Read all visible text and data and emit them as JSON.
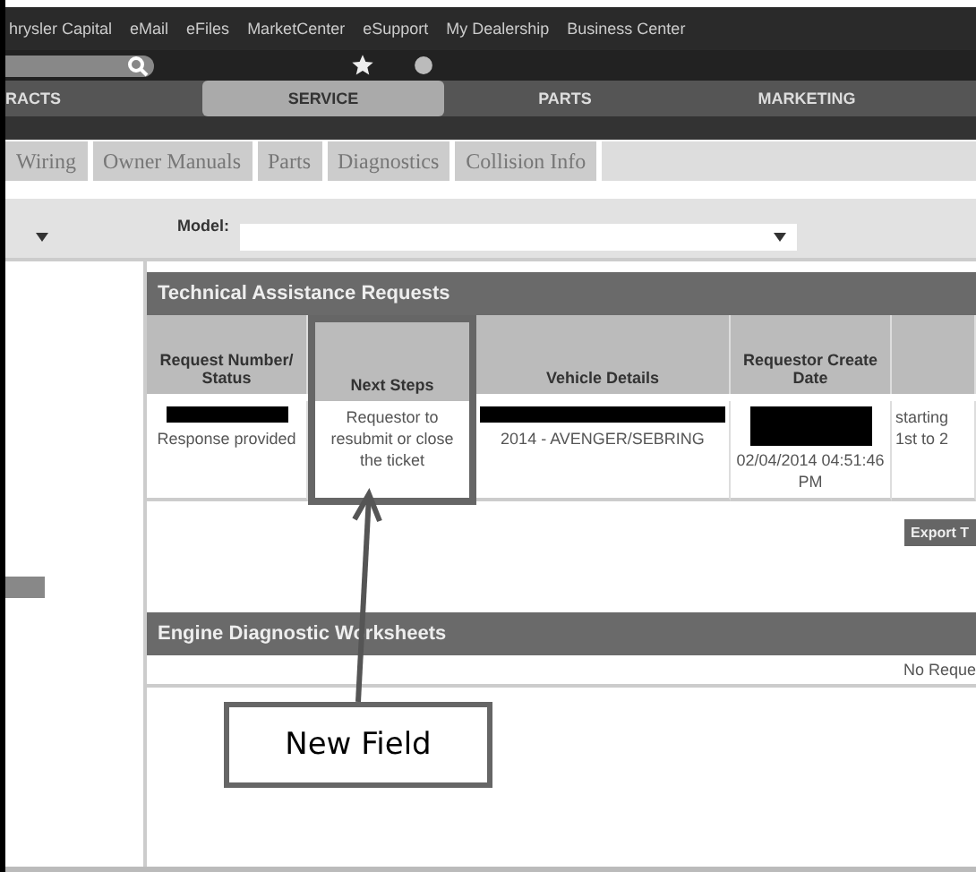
{
  "top_links": [
    "hrysler Capital",
    "eMail",
    "eFiles",
    "MarketCenter",
    "eSupport",
    "My Dealership",
    "Business Center"
  ],
  "nav_tabs": [
    {
      "label": "RACTS",
      "selected": false
    },
    {
      "label": "SERVICE",
      "selected": true
    },
    {
      "label": "PARTS",
      "selected": false
    },
    {
      "label": "MARKETING",
      "selected": false
    }
  ],
  "sub_tabs": [
    "Wiring",
    "Owner Manuals",
    "Parts",
    "Diagnostics",
    "Collision Info"
  ],
  "filter": {
    "label": "Model:"
  },
  "tar_panel": {
    "title": "Technical Assistance Requests",
    "columns": [
      {
        "label": "Request Number/ Status",
        "highlighted": false
      },
      {
        "label": "Next Steps",
        "highlighted": true
      },
      {
        "label": "Vehicle Details",
        "highlighted": false
      },
      {
        "label": "Requestor Create Date",
        "highlighted": false
      },
      {
        "highlighted": false
      }
    ],
    "rows": [
      {
        "cells": [
          {
            "redacted": true,
            "lines": [
              "Response provided"
            ]
          },
          {
            "redacted": false,
            "lines": [
              "Requestor to resubmit or close the ticket"
            ]
          },
          {
            "redacted": true,
            "lines": [
              "2014 - AVENGER/SEBRING"
            ]
          },
          {
            "redacted": true,
            "lines": [
              "02/04/2014 04:51:46 PM"
            ]
          },
          {
            "redacted": false,
            "lines": [
              "starting",
              "1st to 2"
            ]
          }
        ]
      }
    ],
    "export_button": "Export T"
  },
  "edw_panel": {
    "title": "Engine Diagnostic Worksheets",
    "message": "No Reque"
  },
  "annotation": {
    "label": "New Field"
  }
}
